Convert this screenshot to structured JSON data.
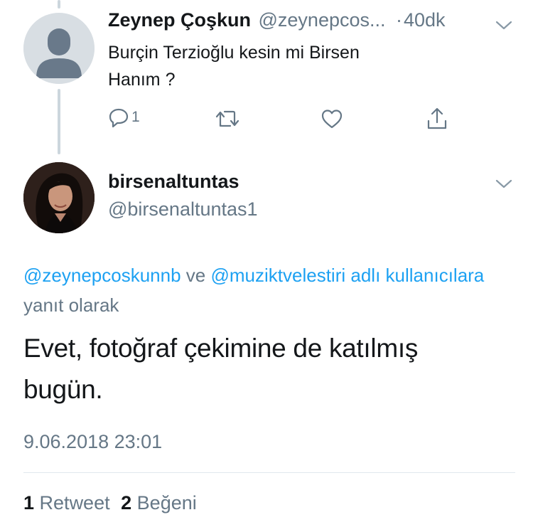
{
  "reply": {
    "display_name": "Zeynep Çoşkun",
    "handle": "@zeynepcos...",
    "separator": "·",
    "time": "40dk",
    "text_line1": "Burçin Terzioğlu kesin mi Birsen",
    "text_line2": "Hanım ?",
    "reply_count": "1",
    "icons": [
      "reply-icon",
      "retweet-icon",
      "like-icon",
      "share-icon",
      "chevron-down-icon",
      "default-avatar-icon"
    ]
  },
  "main_tweet": {
    "display_name": "birsenaltuntas",
    "handle": "@birsenaltuntas1",
    "reply_context": {
      "mention1": "@zeynepcoskunnb",
      "connector": "ve",
      "mention2": "@muziktvelestiri",
      "adli": "adlı",
      "users": "kullanıcılara",
      "suffix": "yanıt olarak"
    },
    "text_line1": "Evet, fotoğraf çekimine de katılmış",
    "text_line2": "bugün.",
    "timestamp": "9.06.2018 23:01",
    "stats": {
      "retweet_count": "1",
      "retweet_label": "Retweet",
      "like_count": "2",
      "like_label": "Beğeni"
    }
  },
  "colors": {
    "link": "#1da1f2",
    "secondary_text": "#657786",
    "primary_text": "#14171a",
    "thread_line": "#ccd6dd"
  }
}
